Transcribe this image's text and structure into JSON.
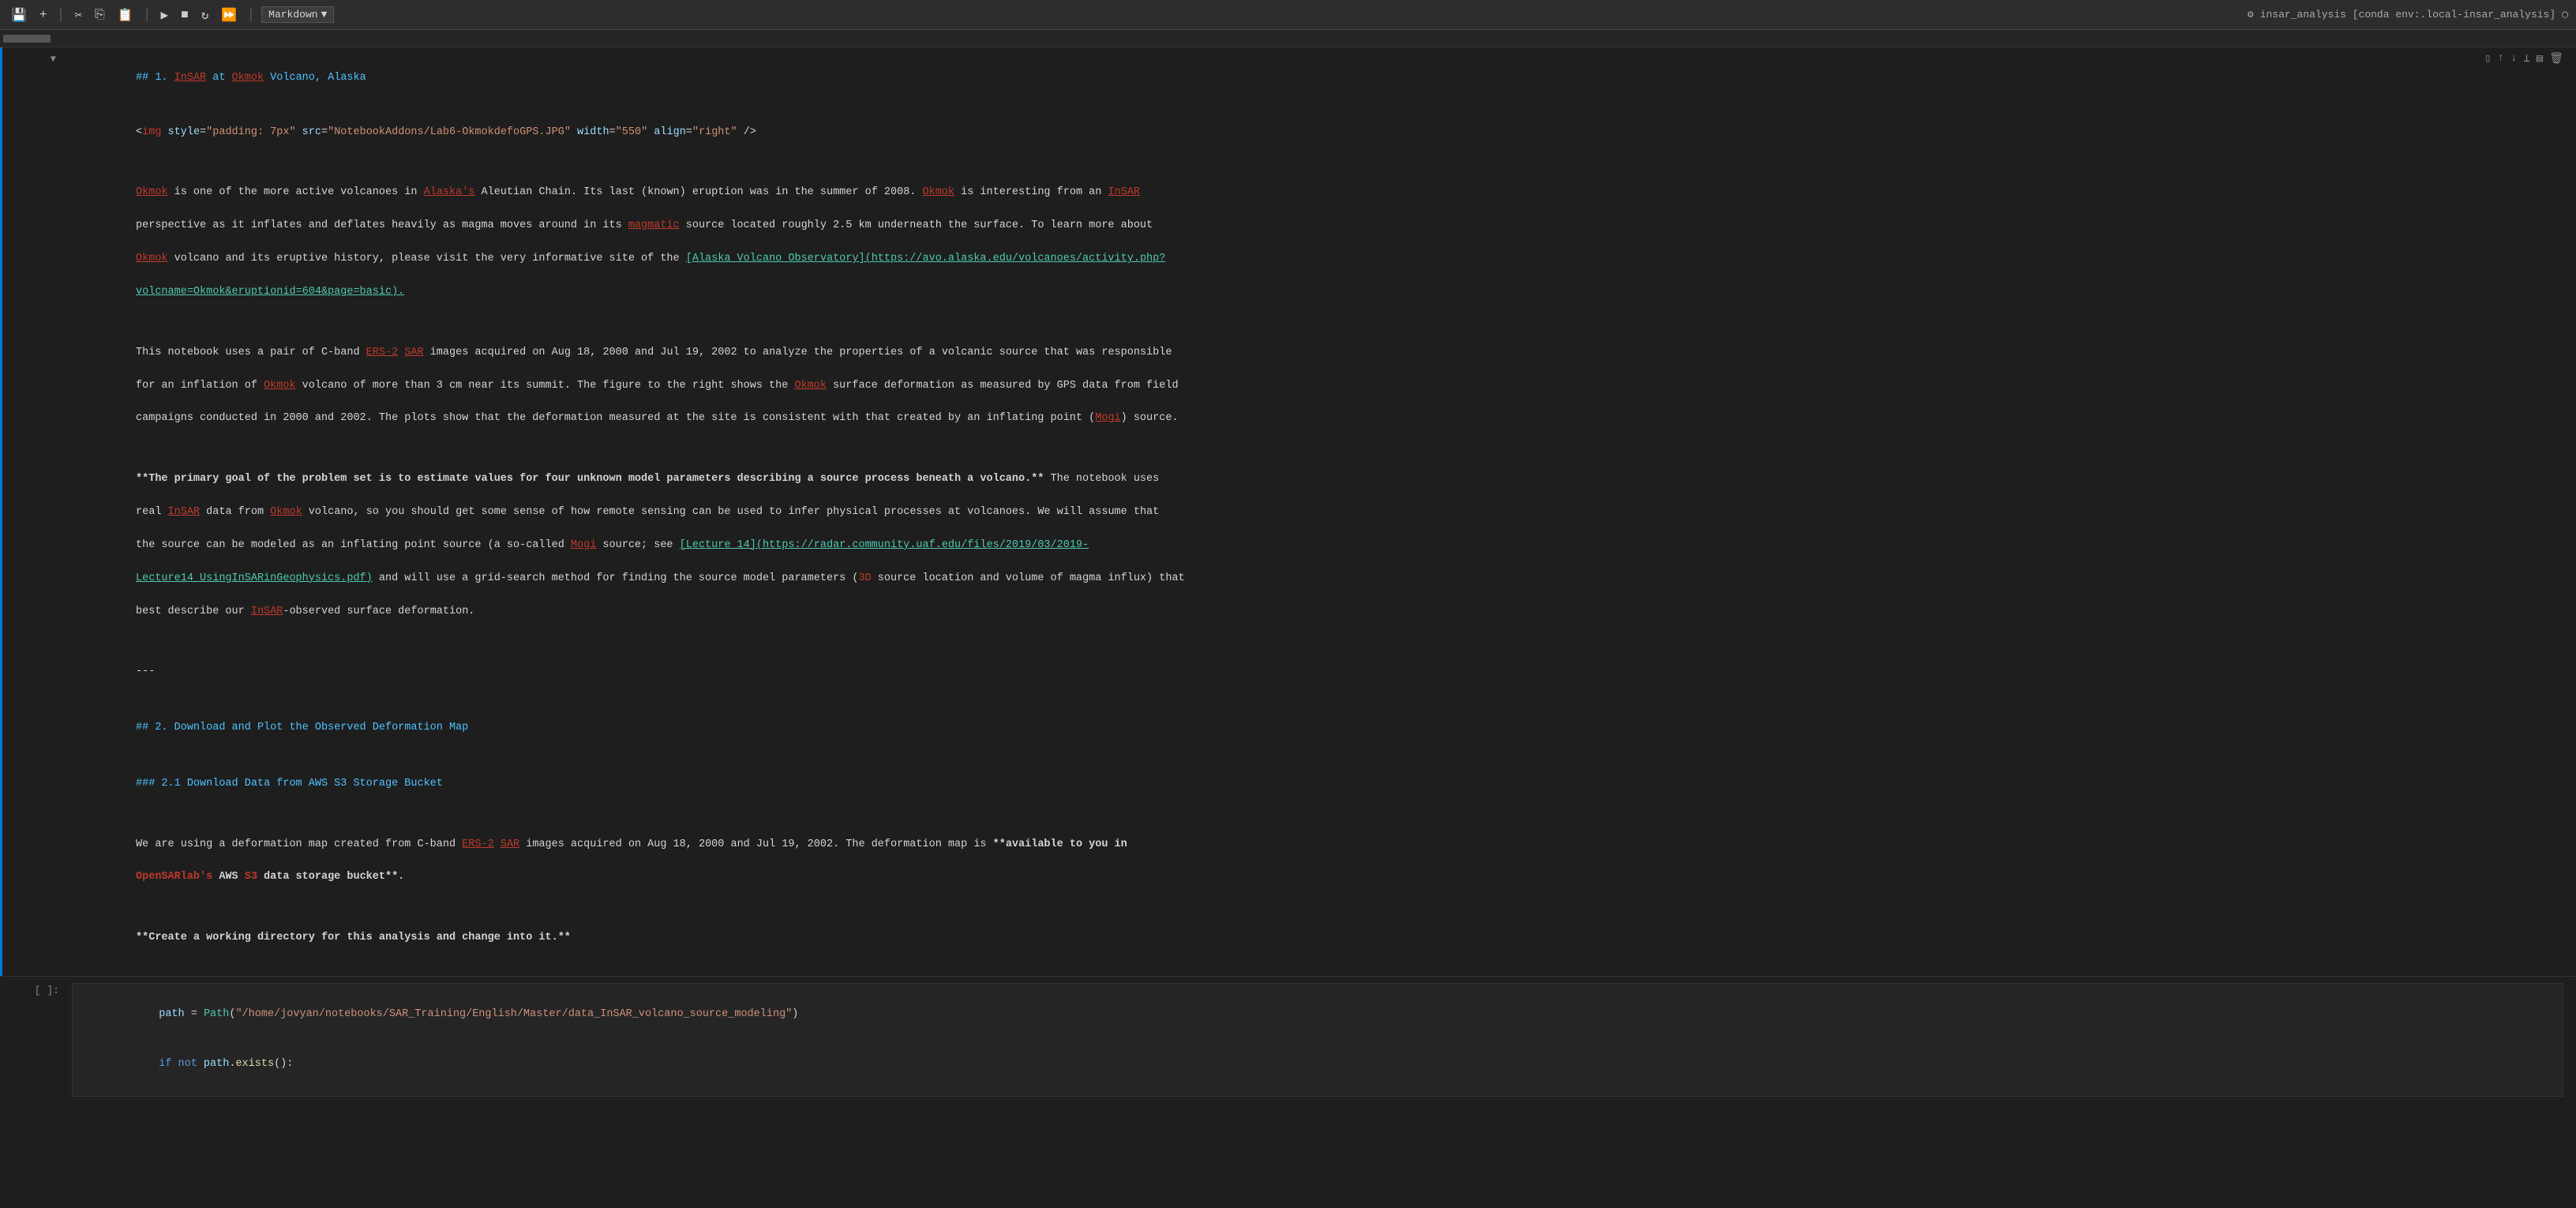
{
  "toolbar": {
    "save_icon": "💾",
    "plus_icon": "+",
    "scissors_icon": "✂",
    "copy_icon": "⬜",
    "paste_icon": "📋",
    "play_icon": "▶",
    "stop_icon": "■",
    "restart_icon": "↺",
    "fast_forward_icon": "⏭",
    "dropdown_label": "Markdown",
    "dropdown_arrow": "▾",
    "kernel_icon": "⚙",
    "kernel_label": "insar_analysis [conda env:.local-insar_analysis]",
    "close_icon": "✕"
  },
  "cell1": {
    "collapse_icon": "▼",
    "line1_comment": "## 1. InSAR at Okmok Volcano, Alaska",
    "line2_img": "<img style=\"padding: 7px\" src=\"NotebookAddons/Lab6-OkmokdefoGPS.JPG\" width=\"550\" align=\"right\" />",
    "body1": "Okmok is one of the more active volcanoes in Alaska's Aleutian Chain. Its last (known) eruption was in the summer of 2008. Okmok is interesting from an InSAR\nperspective as it inflates and deflates heavily as magma moves around in its magmatic source located roughly 2.5 km underneath the surface. To learn more about\nOkmok volcano and its eruptive history, please visit the very informative site of the [Alaska Volcano Observatory](https://avo.alaska.edu/volcanoes/activity.php?volcname=Okmok&eruptionid=604&page=basic).",
    "body2": "This notebook uses a pair of C-band ERS-2 SAR images acquired on Aug 18, 2000 and Jul 19, 2002 to analyze the properties of a volcanic source that was responsible\nfor an inflation of Okmok volcano of more than 3 cm near its summit. The figure to the right shows the Okmok surface deformation as measured by GPS data from field\ncampaigns conducted in 2000 and 2002. The plots show that the deformation measured at the site is consistent with that created by an inflating point (Mogi) source.",
    "body3": "**The primary goal of the problem set is to estimate values for four unknown model parameters describing a source process beneath a volcano.** The notebook uses\nreal InSAR data from Okmok volcano, so you should get some sense of how remote sensing can be used to infer physical processes at volcanoes. We will assume that\nthe source can be modeled as an inflating point source (a so-called Mogi source; see [Lecture 14](https://radar.community.uaf.edu/files/2019/03/2019-Lecture14_UsingInSARinGeophysics.pdf) and will use a grid-search method for finding the source model parameters (3D source location and volume of magma influx) that\nbest describe our InSAR-observed surface deformation.",
    "body4": "---",
    "body5": "## 2. Download and Plot the Observed Deformation Map",
    "body6": "### 2.1 Download Data from AWS S3 Storage Bucket",
    "body7": "We are using a deformation map created from C-band ERS-2 SAR images acquired on Aug 18, 2000 and Jul 19, 2002. The deformation map is **available to you in\nOpenSARlab's AWS S3 data storage bucket**.",
    "body8": "**Create a working directory for this analysis and change into it.**"
  },
  "cell2": {
    "prompt": "[ ]:",
    "line1": "path = Path(\"/home/jovyan/notebooks/SAR_Training/English/Master/data_InSAR_volcano_source_modeling\")",
    "line2": "if not path.exists():"
  }
}
